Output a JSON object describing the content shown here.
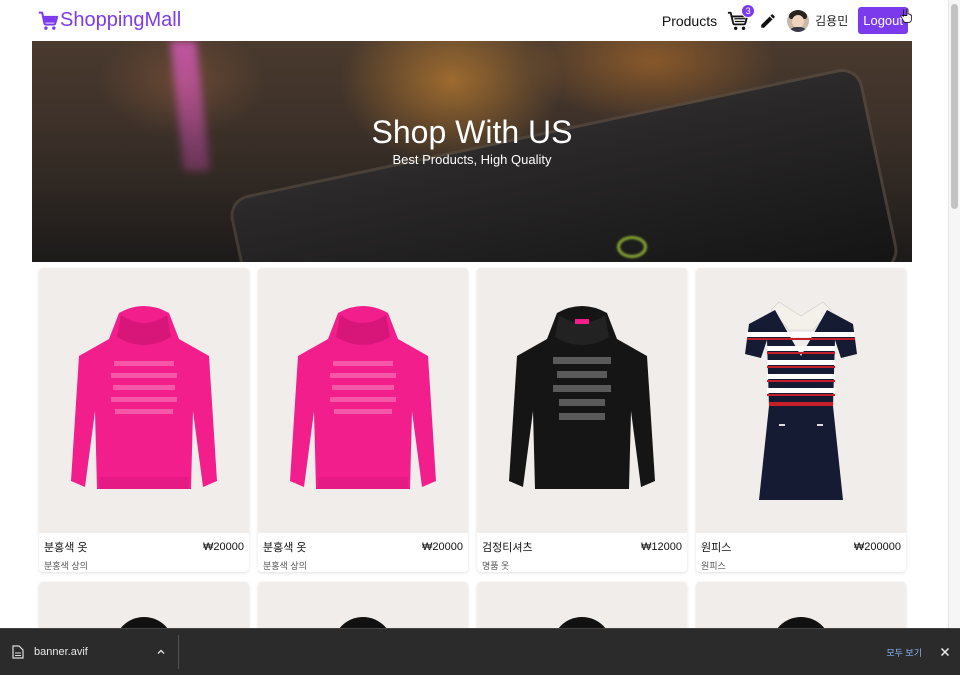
{
  "header": {
    "logo_text": "ShoppingMall",
    "nav_products": "Products",
    "cart_count": "3",
    "username": "김용민",
    "logout_label": "Logout"
  },
  "hero": {
    "title": "Shop With US",
    "subtitle": "Best Products, High Quality"
  },
  "products": [
    {
      "name": "분홍색 옷",
      "price": "₩20000",
      "description": "분홍색 상의",
      "image_type": "pink-hoodie"
    },
    {
      "name": "분홍색 옷",
      "price": "₩20000",
      "description": "분홍색 상의",
      "image_type": "pink-hoodie"
    },
    {
      "name": "검정티셔츠",
      "price": "₩12000",
      "description": "명품 옷",
      "image_type": "black-hoodie"
    },
    {
      "name": "원피스",
      "price": "₩200000",
      "description": "원피스",
      "image_type": "striped-dress"
    }
  ],
  "download_bar": {
    "filename": "banner.avif",
    "show_all": "모두 보기"
  },
  "colors": {
    "accent": "#7c3aed",
    "pink_product": "#f21e8c",
    "card_bg": "#f0edea"
  }
}
